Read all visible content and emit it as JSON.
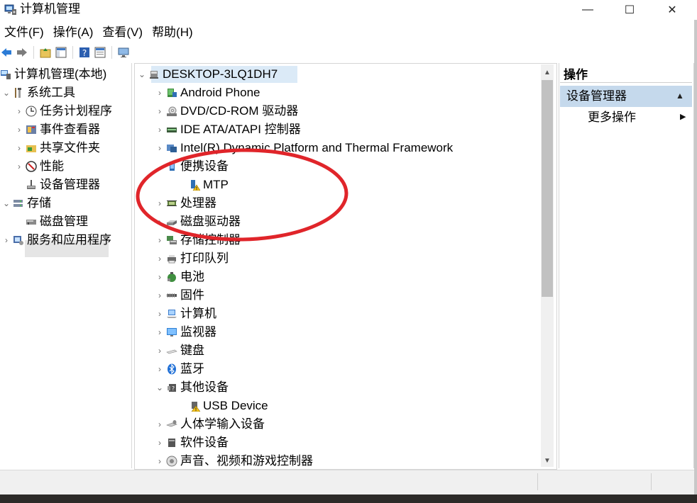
{
  "window": {
    "title": "计算机管理",
    "buttons": {
      "minimize": "—",
      "maximize": "☐",
      "close": "✕"
    }
  },
  "menu": [
    "文件(F)",
    "操作(A)",
    "查看(V)",
    "帮助(H)"
  ],
  "toolbar": [
    "back-icon",
    "forward-icon",
    "up-icon",
    "show-hide-tree-icon",
    "help-icon",
    "properties-icon",
    "monitor-icon"
  ],
  "left_tree": {
    "root": "计算机管理(本地)",
    "items": [
      {
        "label": "系统工具",
        "expanded": true
      },
      {
        "label": "任务计划程序"
      },
      {
        "label": "事件查看器"
      },
      {
        "label": "共享文件夹"
      },
      {
        "label": "性能"
      },
      {
        "label": "设备管理器",
        "selected": true
      },
      {
        "label": "存储",
        "expanded": true
      },
      {
        "label": "磁盘管理"
      },
      {
        "label": "服务和应用程序"
      }
    ]
  },
  "device_tree": {
    "root": "DESKTOP-3LQ1DH7",
    "items": [
      {
        "label": "Android Phone",
        "icon": "phone-icon"
      },
      {
        "label": "DVD/CD-ROM 驱动器",
        "icon": "dvd-icon"
      },
      {
        "label": "IDE ATA/ATAPI 控制器",
        "icon": "ide-icon"
      },
      {
        "label": "Intel(R) Dynamic Platform and Thermal Framework",
        "icon": "intel-icon"
      },
      {
        "label": "便携设备",
        "icon": "portable-device-icon",
        "expanded": true
      },
      {
        "label": "MTP",
        "icon": "mtp-warning-icon",
        "child": true
      },
      {
        "label": "处理器",
        "icon": "processor-icon"
      },
      {
        "label": "磁盘驱动器",
        "icon": "disk-icon"
      },
      {
        "label": "存储控制器",
        "icon": "storage-controller-icon"
      },
      {
        "label": "打印队列",
        "icon": "printer-icon"
      },
      {
        "label": "电池",
        "icon": "battery-icon"
      },
      {
        "label": "固件",
        "icon": "firmware-icon"
      },
      {
        "label": "计算机",
        "icon": "computer-icon"
      },
      {
        "label": "监视器",
        "icon": "monitor-icon"
      },
      {
        "label": "键盘",
        "icon": "keyboard-icon"
      },
      {
        "label": "蓝牙",
        "icon": "bluetooth-icon"
      },
      {
        "label": "其他设备",
        "icon": "other-devices-icon",
        "expanded": true
      },
      {
        "label": "USB Device",
        "icon": "usb-warning-icon",
        "child": true
      },
      {
        "label": "人体学输入设备",
        "icon": "hid-icon"
      },
      {
        "label": "软件设备",
        "icon": "software-device-icon"
      },
      {
        "label": "声音、视频和游戏控制器",
        "icon": "sound-icon"
      }
    ]
  },
  "actions": {
    "header": "操作",
    "section": "设备管理器",
    "more": "更多操作"
  },
  "colors": {
    "selection": "#dbeaf7",
    "action_section": "#c5d9ec",
    "annotation": "#e0252a"
  }
}
